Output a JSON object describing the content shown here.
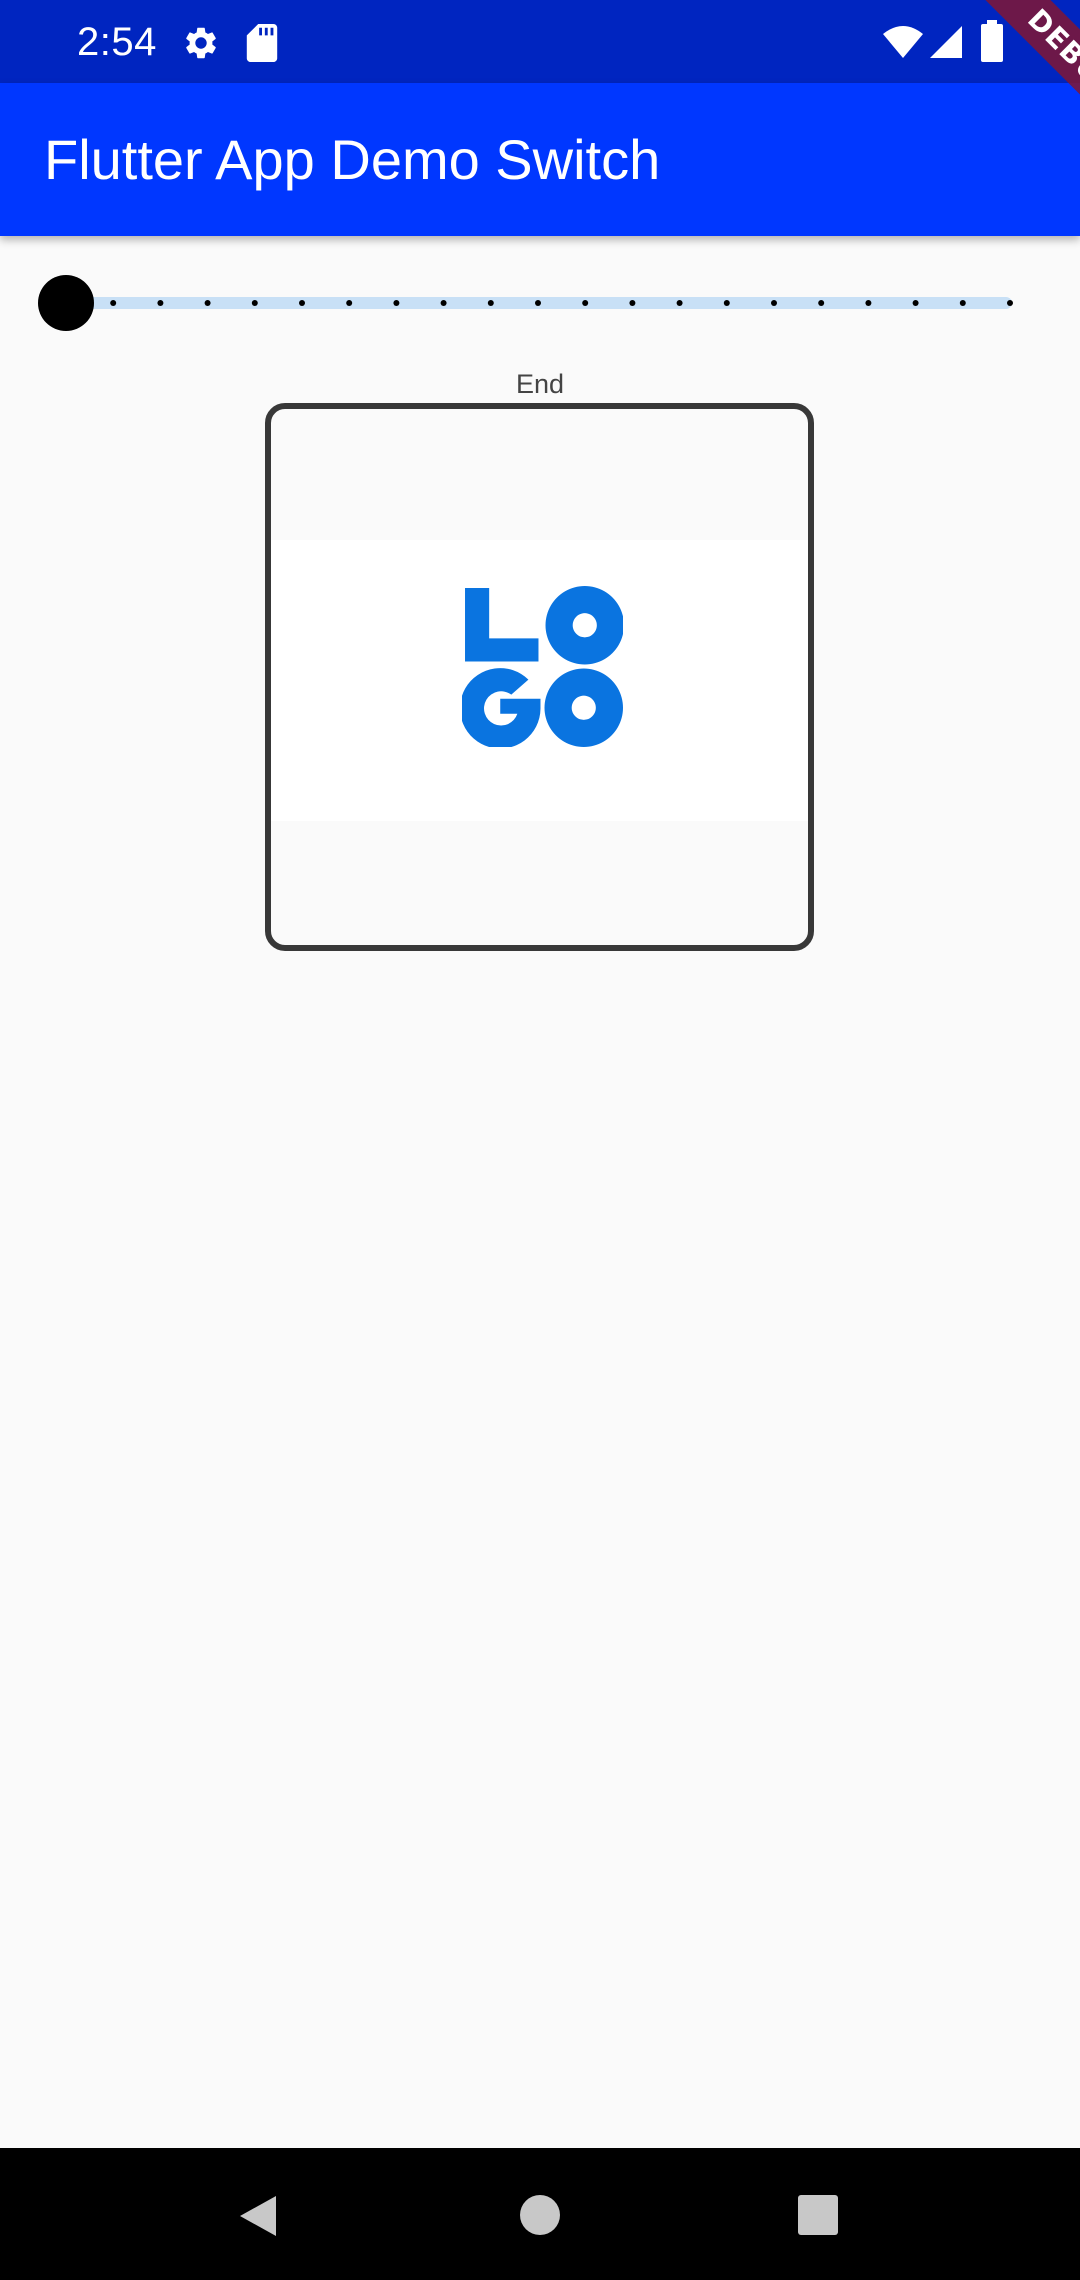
{
  "status_bar": {
    "time": "2:54",
    "icons": [
      "gear-icon",
      "sd-card-icon",
      "wifi-icon",
      "cell-signal-icon",
      "battery-icon"
    ]
  },
  "app_bar": {
    "title": "Flutter App Demo Switch"
  },
  "debug_banner": {
    "label": "DEBUG"
  },
  "slider": {
    "value_fraction": 0.0,
    "divisions": 20
  },
  "state_label": "End",
  "logo": {
    "letters": "LOGO",
    "color": "#0a74e0"
  },
  "nav_bar": {
    "icons": [
      "back-icon",
      "home-icon",
      "recents-icon"
    ]
  },
  "colors": {
    "status_bar": "#0025c0",
    "app_bar": "#0037ff",
    "background": "#fafafa",
    "slider_track": "#c8e0f6",
    "slider_thumb": "#000000",
    "logo_blue": "#0a74e0"
  }
}
